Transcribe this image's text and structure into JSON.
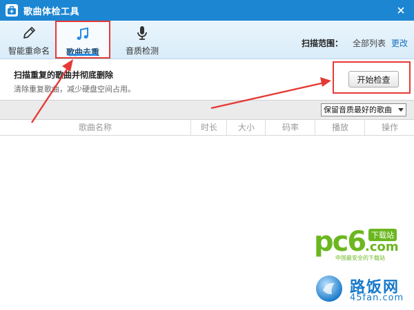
{
  "window": {
    "title": "歌曲体检工具"
  },
  "toolbar": {
    "tools": [
      {
        "label": "智能重命名",
        "icon": "pencil-icon"
      },
      {
        "label": "歌曲去重",
        "icon": "music-note-icon",
        "active": true
      },
      {
        "label": "音质检测",
        "icon": "microphone-icon"
      }
    ],
    "scan_range_label": "扫描范围：",
    "scan_range_value": "全部列表",
    "scan_range_change": "更改"
  },
  "info": {
    "title": "扫描重复的歌曲并彻底删除",
    "subtitle": "清除重复歌曲，减少硬盘空间占用。",
    "start_button": "开始检查"
  },
  "options": {
    "keep_select": "保留音质最好的歌曲"
  },
  "table": {
    "columns": [
      "歌曲名称",
      "时长",
      "大小",
      "码率",
      "播放",
      "操作"
    ]
  },
  "watermarks": {
    "pc6_logo": "pc6",
    "pc6_com": ".com",
    "pc6_badge": "下载站",
    "pc6_sub": "中国最安全的下载站",
    "lufan_name": "路饭网",
    "lufan_domain": "45fan.com"
  },
  "colors": {
    "titlebar": "#1d86d2",
    "annotation_red": "#e53935",
    "link_blue": "#1a6fc0",
    "pc6_green": "#6bb71f"
  }
}
